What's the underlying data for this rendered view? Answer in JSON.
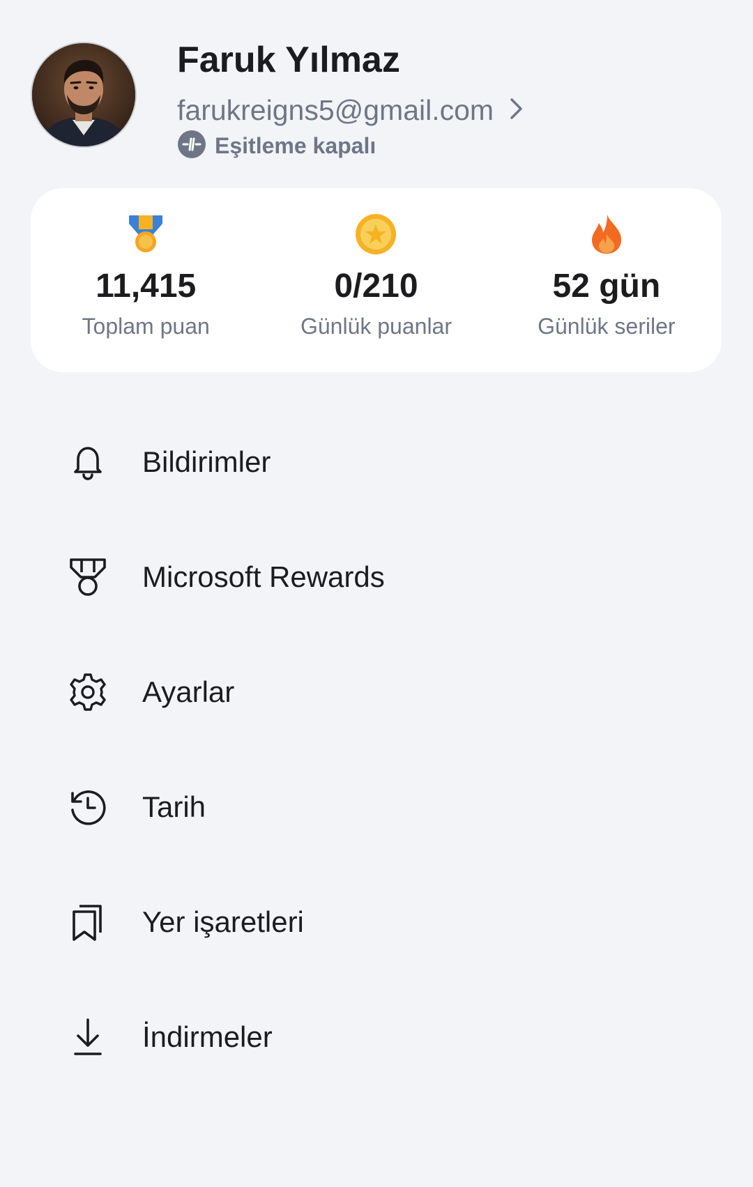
{
  "profile": {
    "name": "Faruk Yılmaz",
    "email": "farukreigns5@gmail.com",
    "status": "Eşitleme kapalı"
  },
  "stats": [
    {
      "value": "11,415",
      "label": "Toplam puan",
      "icon": "medal-icon"
    },
    {
      "value": "0/210",
      "label": "Günlük puanlar",
      "icon": "coin-star-icon"
    },
    {
      "value": "52 gün",
      "label": "Günlük seriler",
      "icon": "flame-icon"
    }
  ],
  "menu": {
    "items": [
      {
        "label": "Bildirimler",
        "icon": "bell-icon"
      },
      {
        "label": "Microsoft Rewards",
        "icon": "rewards-medal-icon"
      },
      {
        "label": "Ayarlar",
        "icon": "gear-icon"
      },
      {
        "label": "Tarih",
        "icon": "history-icon"
      },
      {
        "label": "Yer işaretleri",
        "icon": "bookmarks-icon"
      },
      {
        "label": "İndirmeler",
        "icon": "download-icon"
      }
    ]
  },
  "colors": {
    "background": "#f2f4f8",
    "card": "#ffffff",
    "text_primary": "#1c1c1e",
    "text_secondary": "#6e7686",
    "medal_ribbon": "#3b82d6",
    "medal_gold": "#f5b324",
    "coin": "#f7c948",
    "flame": "#f26b21"
  }
}
